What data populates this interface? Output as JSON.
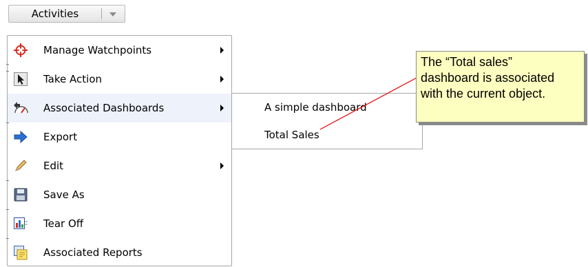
{
  "activities_button": {
    "label": "Activities",
    "dropdown_icon": "chevron-down-icon"
  },
  "menu": {
    "items": [
      {
        "label": "Manage Watchpoints",
        "icon": "crosshair-icon",
        "has_submenu": true
      },
      {
        "label": "Take Action",
        "icon": "cursor-icon",
        "has_submenu": true
      },
      {
        "label": "Associated Dashboards",
        "icon": "dashboard-link-icon",
        "has_submenu": true,
        "highlighted": true
      },
      {
        "label": "Export",
        "icon": "export-arrow-icon",
        "has_submenu": false
      },
      {
        "label": "Edit",
        "icon": "pencil-icon",
        "has_submenu": true
      },
      {
        "label": "Save As",
        "icon": "floppy-icon",
        "has_submenu": false
      },
      {
        "label": "Tear Off",
        "icon": "tear-off-chart-icon",
        "has_submenu": false
      },
      {
        "label": "Associated Reports",
        "icon": "reports-icon",
        "has_submenu": false
      }
    ]
  },
  "submenu": {
    "items": [
      {
        "label": "A simple dashboard"
      },
      {
        "label": "Total Sales"
      }
    ]
  },
  "callout": {
    "lines": [
      "The “Total sales”",
      "dashboard is associated",
      "with the current object."
    ],
    "background": "#fdffc0",
    "leader_color": "#e00000"
  },
  "colors": {
    "menu_highlight": "#eef2fb",
    "menu_border": "#a6a6a6"
  }
}
